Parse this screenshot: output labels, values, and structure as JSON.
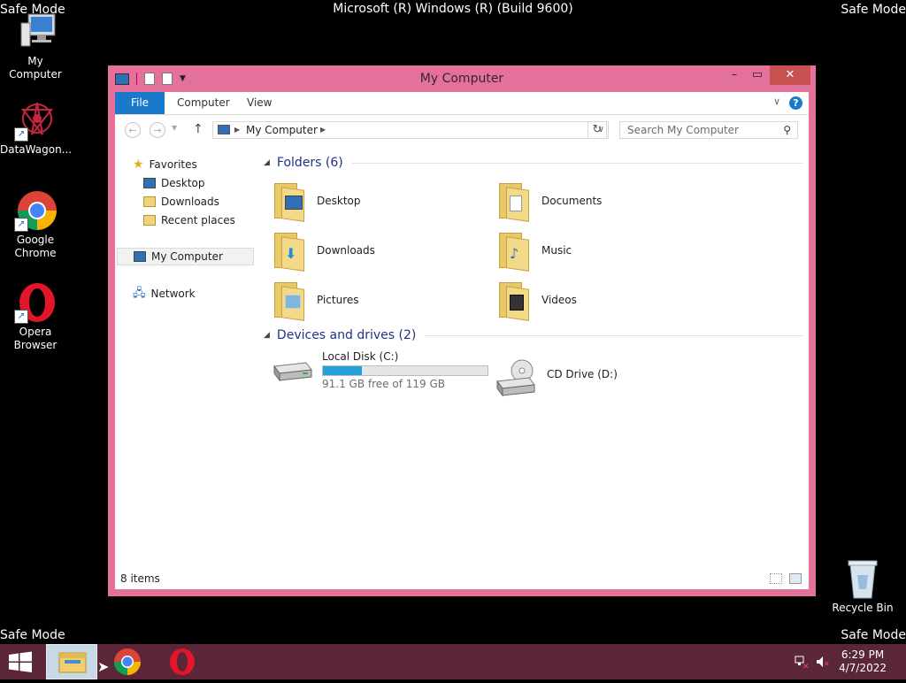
{
  "desktop": {
    "safe_mode": "Safe Mode",
    "build": "Microsoft (R) Windows (R) (Build 9600)",
    "icons": [
      {
        "label": "My Computer"
      },
      {
        "label": "DataWagon..."
      },
      {
        "label": "Google Chrome"
      },
      {
        "label": "Opera Browser"
      },
      {
        "label": "Recycle Bin"
      }
    ]
  },
  "window": {
    "title": "My Computer",
    "ribbon_tabs": [
      "File",
      "Computer",
      "View"
    ],
    "help": "?",
    "address": "My Computer",
    "search_placeholder": "Search My Computer",
    "nav": {
      "favorites": "Favorites",
      "favorites_items": [
        "Desktop",
        "Downloads",
        "Recent places"
      ],
      "my_computer": "My Computer",
      "network": "Network"
    },
    "folders_header": "Folders (6)",
    "folders": [
      "Desktop",
      "Documents",
      "Downloads",
      "Music",
      "Pictures",
      "Videos"
    ],
    "devices_header": "Devices and drives (2)",
    "drives": [
      {
        "name": "Local Disk (C:)",
        "free": "91.1 GB free of 119 GB",
        "used_fraction": 0.234
      },
      {
        "name": "CD Drive (D:)"
      }
    ],
    "status": "8 items"
  },
  "taskbar": {
    "time": "6:29 PM",
    "date": "4/7/2022"
  },
  "colors": {
    "window_frame": "#e4719b",
    "taskbar": "#5b2638",
    "accent": "#1979ca",
    "drive_bar": "#26a0da"
  }
}
